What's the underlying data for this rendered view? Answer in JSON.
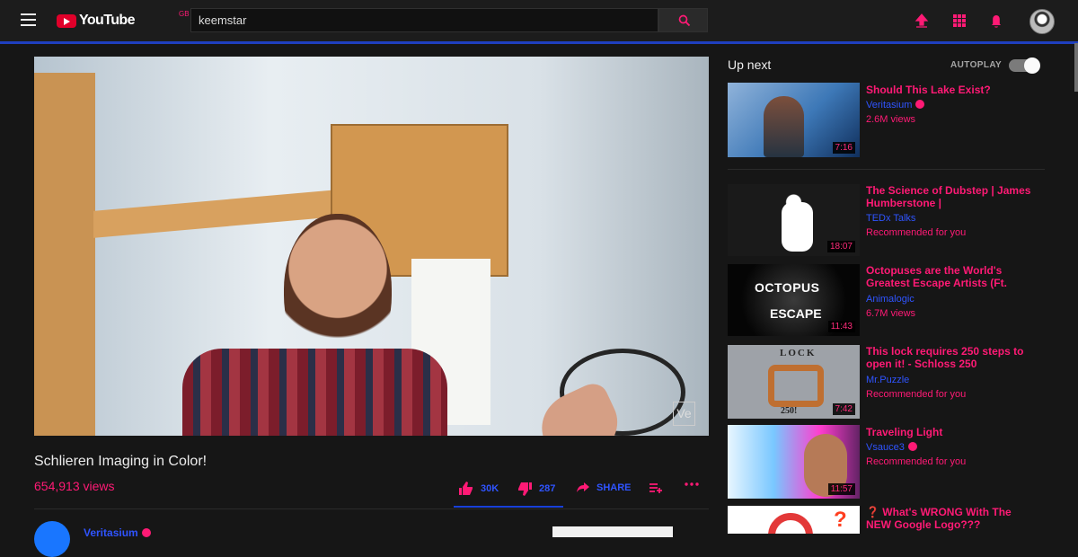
{
  "header": {
    "logo_text": "YouTube",
    "country": "GB",
    "search_value": "keemstar",
    "icons": [
      "menu-icon",
      "upload-icon",
      "apps-icon",
      "notifications-icon",
      "account-avatar"
    ]
  },
  "player": {
    "watermark": "Ve"
  },
  "video": {
    "title": "Schlieren Imaging in Color!",
    "views": "654,913 views",
    "likes": "30K",
    "dislikes": "287",
    "share_label": "SHARE",
    "channel_name": "Veritasium"
  },
  "sidebar": {
    "up_next_label": "Up next",
    "autoplay_label": "AUTOPLAY",
    "autoplay_on": true,
    "items": [
      {
        "title": "Should This Lake Exist?",
        "channel": "Veritasium",
        "verified": true,
        "meta": "2.6M views",
        "duration": "7:16"
      },
      {
        "title": "The Science of Dubstep | James Humberstone |",
        "channel": "TEDx Talks",
        "verified": false,
        "meta": "Recommended for you",
        "duration": "18:07"
      },
      {
        "title": "Octopuses are the World's Greatest Escape Artists (Ft.",
        "channel": "Animalogic",
        "verified": false,
        "meta": "6.7M views",
        "duration": "11:43",
        "thumb_text_1": "OCTOPUS",
        "thumb_text_2": "ESCAPE"
      },
      {
        "title": "This lock requires 250 steps to open it! - Schloss 250",
        "channel": "Mr.Puzzle",
        "verified": false,
        "meta": "Recommended for you",
        "duration": "7:42",
        "thumb_text_1": "LOCK",
        "thumb_text_2": "250!"
      },
      {
        "title": "Traveling Light",
        "channel": "Vsauce3",
        "verified": true,
        "meta": "Recommended for you",
        "duration": "11:57"
      },
      {
        "title": "What's WRONG With The NEW Google Logo???",
        "prefix": "❓"
      }
    ]
  },
  "colors": {
    "accent_pink": "#ff1a75",
    "accent_blue": "#2f54ff",
    "background": "#161616"
  }
}
